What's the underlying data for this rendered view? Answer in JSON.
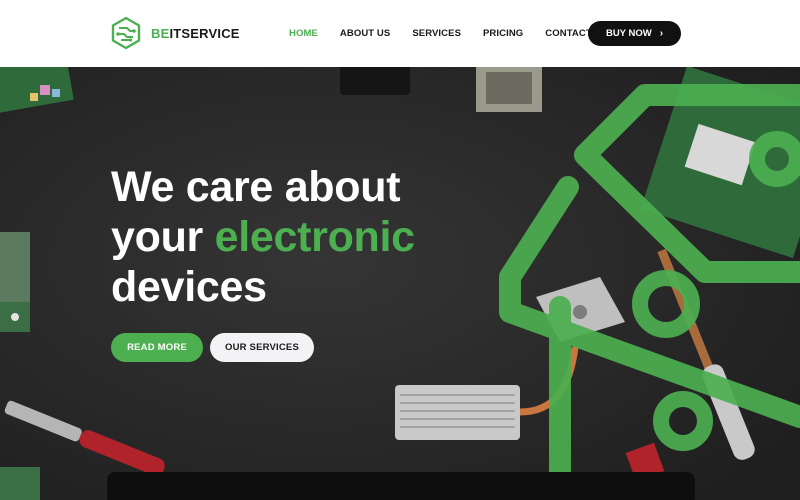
{
  "brand": {
    "name_accent": "BE",
    "name_rest": "ITSERVICE"
  },
  "nav": {
    "items": [
      {
        "label": "HOME",
        "active": true
      },
      {
        "label": "ABOUT US",
        "active": false
      },
      {
        "label": "SERVICES",
        "active": false
      },
      {
        "label": "PRICING",
        "active": false
      },
      {
        "label": "CONTACT",
        "active": false
      }
    ],
    "cta_label": "BUY NOW"
  },
  "hero": {
    "line1": "We care about",
    "line2_plain": "your ",
    "line2_accent": "electronic",
    "line3": "devices",
    "primary_button": "READ MORE",
    "secondary_button": "OUR SERVICES"
  },
  "colors": {
    "accent": "#4caf50",
    "dark": "#111111",
    "hero_bg": "#2b2b2b",
    "light_button": "#f3f3f6"
  }
}
